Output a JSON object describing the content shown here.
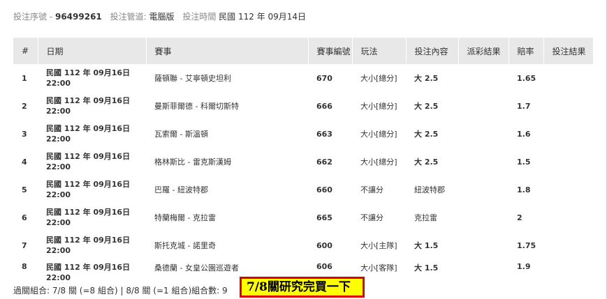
{
  "info": {
    "serial_label": "投注序號 -",
    "serial_value": "96499261",
    "channel_label": "投注管道:",
    "channel_value": "電腦版",
    "time_label": "投注時間",
    "time_value": "民國 112 年 09月14日"
  },
  "table": {
    "headers": [
      "#",
      "日期",
      "賽事",
      "賽事編號",
      "玩法",
      "投注內容",
      "派彩結果",
      "賠率",
      "投注結果"
    ],
    "rows": [
      {
        "no": "1",
        "date": "民國 112 年 09月16日",
        "time": "22:00",
        "match": "薩頓聯 - 艾寧頓史坦利",
        "code": "670",
        "play": "大小[總分]",
        "content": "大 2.5",
        "payout": "",
        "odds": "1.65",
        "result": ""
      },
      {
        "no": "2",
        "date": "民國 112 年 09月16日",
        "time": "22:00",
        "match": "曼斯菲爾德 - 科爾切斯特",
        "code": "666",
        "play": "大小[總分]",
        "content": "大 2.5",
        "payout": "",
        "odds": "1.7",
        "result": ""
      },
      {
        "no": "3",
        "date": "民國 112 年 09月16日",
        "time": "22:00",
        "match": "瓦索爾 - 斯溫頓",
        "code": "663",
        "play": "大小[總分]",
        "content": "大 2.5",
        "payout": "",
        "odds": "1.6",
        "result": ""
      },
      {
        "no": "4",
        "date": "民國 112 年 09月16日",
        "time": "22:00",
        "match": "格林斯比 - 雷克斯漢姆",
        "code": "662",
        "play": "大小[總分]",
        "content": "大 2.5",
        "payout": "",
        "odds": "1.5",
        "result": ""
      },
      {
        "no": "5",
        "date": "民國 112 年 09月16日",
        "time": "22:00",
        "match": "巴羅 - 紐波特郡",
        "code": "660",
        "play": "不讓分",
        "content": "紐波特郡",
        "payout": "",
        "odds": "1.8",
        "result": ""
      },
      {
        "no": "6",
        "date": "民國 112 年 09月16日",
        "time": "22:00",
        "match": "特蘭梅爾 - 克拉雷",
        "code": "665",
        "play": "不讓分",
        "content": "克拉雷",
        "payout": "",
        "odds": "2",
        "result": ""
      },
      {
        "no": "7",
        "date": "民國 112 年 09月16日",
        "time": "22:00",
        "match": "斯托克城 - 諾里奇",
        "code": "600",
        "play": "大小[主隊]",
        "content": "大 1.5",
        "payout": "",
        "odds": "1.75",
        "result": ""
      },
      {
        "no": "8",
        "date": "民國 112 年 09月16日",
        "time": "22:00",
        "match": "桑德蘭 - 女皇公園巡遊者",
        "code": "606",
        "play": "大小[客隊]",
        "content": "大 1.5",
        "payout": "",
        "odds": "1.9",
        "result": ""
      }
    ]
  },
  "summary": "過關組合: 7/8 關 (=8 組合) | 8/8 關 (=1 組合)組合數: 9",
  "note": "7/8關研究完買一下"
}
